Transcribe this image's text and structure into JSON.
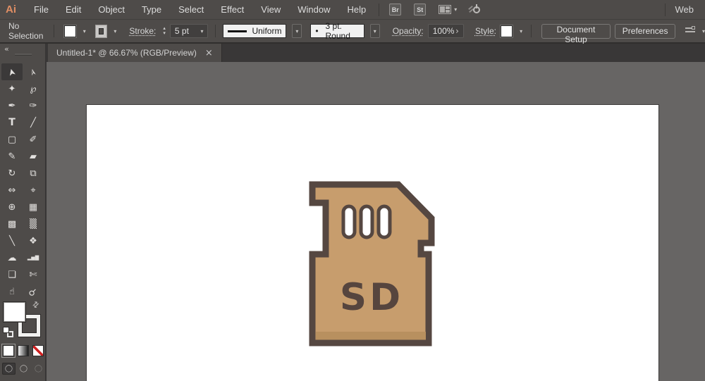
{
  "app": {
    "logo_text": "Ai",
    "workspace": "Web"
  },
  "menu": {
    "items": [
      "File",
      "Edit",
      "Object",
      "Type",
      "Select",
      "Effect",
      "View",
      "Window",
      "Help"
    ],
    "br_label": "Br",
    "st_label": "St"
  },
  "control_bar": {
    "selection_status": "No Selection",
    "stroke_label": "Stroke:",
    "stroke_weight": "5 pt",
    "width_profile": "Uniform",
    "brush_dot": "•",
    "brush": "3 pt. Round",
    "opacity_label": "Opacity:",
    "opacity_value": "100%",
    "style_label": "Style:",
    "document_setup_label": "Document Setup",
    "preferences_label": "Preferences"
  },
  "document_tab": {
    "title": "Untitled-1* @ 66.67% (RGB/Preview)",
    "close_glyph": "×"
  },
  "icons": {
    "chevron": "▾",
    "up": "▴",
    "down": "▾",
    "submenu_arrow": "›",
    "swap": "⇄",
    "collapse": "«",
    "circle": "◯"
  },
  "toolbar": {
    "tools": [
      {
        "name": "selection",
        "glyph": "➤"
      },
      {
        "name": "direct-selection",
        "glyph": "➢"
      },
      {
        "name": "magic-wand",
        "glyph": "✦"
      },
      {
        "name": "lasso",
        "glyph": "℘"
      },
      {
        "name": "pen",
        "glyph": "✒"
      },
      {
        "name": "curvature",
        "glyph": "✑"
      },
      {
        "name": "type",
        "glyph": "T"
      },
      {
        "name": "line-segment",
        "glyph": "╱"
      },
      {
        "name": "rectangle",
        "glyph": "▢"
      },
      {
        "name": "paintbrush",
        "glyph": "✐"
      },
      {
        "name": "pencil",
        "glyph": "✎"
      },
      {
        "name": "eraser",
        "glyph": "▰"
      },
      {
        "name": "rotate",
        "glyph": "↻"
      },
      {
        "name": "scale",
        "glyph": "⧉"
      },
      {
        "name": "width",
        "glyph": "⇔"
      },
      {
        "name": "puppet-warp",
        "glyph": "⌖"
      },
      {
        "name": "shape-builder",
        "glyph": "⊕"
      },
      {
        "name": "perspective-grid",
        "glyph": "▦"
      },
      {
        "name": "mesh",
        "glyph": "▩"
      },
      {
        "name": "gradient",
        "glyph": "▒"
      },
      {
        "name": "eyedropper",
        "glyph": "╲"
      },
      {
        "name": "blend",
        "glyph": "❖"
      },
      {
        "name": "symbol-sprayer",
        "glyph": "☁"
      },
      {
        "name": "column-graph",
        "glyph": "▂▅▇"
      },
      {
        "name": "artboard",
        "glyph": "❏"
      },
      {
        "name": "slice",
        "glyph": "✄"
      },
      {
        "name": "hand",
        "glyph": "☝"
      },
      {
        "name": "zoom",
        "glyph": "⚲"
      }
    ]
  },
  "artwork": {
    "label": "SD",
    "body_color": "#C79D6D",
    "outline_color": "#554741",
    "label_color": "#56453E",
    "shade_color": "#B8905F",
    "slot_fill": "#FFFFFF"
  },
  "colors": {
    "bar_bg": "#4E4B49",
    "tab_strip_bg": "#393737",
    "canvas_bg": "#676564",
    "logo_accent": "#E08E64"
  }
}
